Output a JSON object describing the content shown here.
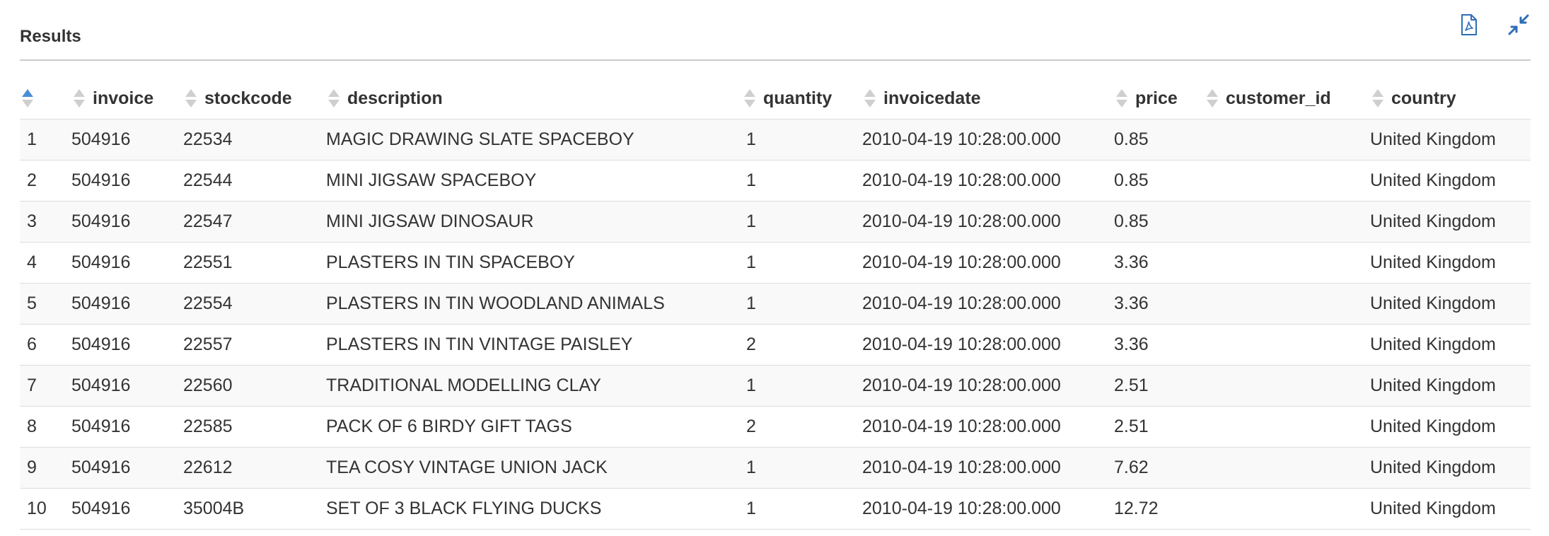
{
  "panel": {
    "title": "Results",
    "icons": [
      "export-pdf-icon",
      "collapse-icon"
    ],
    "accent_color": "#2e6db4",
    "sort_inactive_color": "#cfcfcf",
    "sort_active_color": "#4a8fd6"
  },
  "table": {
    "columns": [
      {
        "key": "index",
        "label": "",
        "sort": "asc"
      },
      {
        "key": "invoice",
        "label": "invoice",
        "sort": "none"
      },
      {
        "key": "stockcode",
        "label": "stockcode",
        "sort": "none"
      },
      {
        "key": "description",
        "label": "description",
        "sort": "none"
      },
      {
        "key": "quantity",
        "label": "quantity",
        "sort": "none"
      },
      {
        "key": "invoicedate",
        "label": "invoicedate",
        "sort": "none"
      },
      {
        "key": "price",
        "label": "price",
        "sort": "none"
      },
      {
        "key": "customer_id",
        "label": "customer_id",
        "sort": "none"
      },
      {
        "key": "country",
        "label": "country",
        "sort": "none"
      }
    ],
    "rows": [
      [
        "1",
        "504916",
        "22534",
        "MAGIC DRAWING SLATE SPACEBOY",
        "1",
        "2010-04-19 10:28:00.000",
        "0.85",
        "",
        "United Kingdom"
      ],
      [
        "2",
        "504916",
        "22544",
        "MINI JIGSAW SPACEBOY",
        "1",
        "2010-04-19 10:28:00.000",
        "0.85",
        "",
        "United Kingdom"
      ],
      [
        "3",
        "504916",
        "22547",
        "MINI JIGSAW DINOSAUR",
        "1",
        "2010-04-19 10:28:00.000",
        "0.85",
        "",
        "United Kingdom"
      ],
      [
        "4",
        "504916",
        "22551",
        "PLASTERS IN TIN SPACEBOY",
        "1",
        "2010-04-19 10:28:00.000",
        "3.36",
        "",
        "United Kingdom"
      ],
      [
        "5",
        "504916",
        "22554",
        "PLASTERS IN TIN WOODLAND ANIMALS",
        "1",
        "2010-04-19 10:28:00.000",
        "3.36",
        "",
        "United Kingdom"
      ],
      [
        "6",
        "504916",
        "22557",
        "PLASTERS IN TIN VINTAGE PAISLEY",
        "2",
        "2010-04-19 10:28:00.000",
        "3.36",
        "",
        "United Kingdom"
      ],
      [
        "7",
        "504916",
        "22560",
        "TRADITIONAL MODELLING CLAY",
        "1",
        "2010-04-19 10:28:00.000",
        "2.51",
        "",
        "United Kingdom"
      ],
      [
        "8",
        "504916",
        "22585",
        "PACK OF 6 BIRDY GIFT TAGS",
        "2",
        "2010-04-19 10:28:00.000",
        "2.51",
        "",
        "United Kingdom"
      ],
      [
        "9",
        "504916",
        "22612",
        "TEA COSY VINTAGE UNION JACK",
        "1",
        "2010-04-19 10:28:00.000",
        "7.62",
        "",
        "United Kingdom"
      ],
      [
        "10",
        "504916",
        "35004B",
        "SET OF 3 BLACK FLYING DUCKS",
        "1",
        "2010-04-19 10:28:00.000",
        "12.72",
        "",
        "United Kingdom"
      ]
    ]
  }
}
